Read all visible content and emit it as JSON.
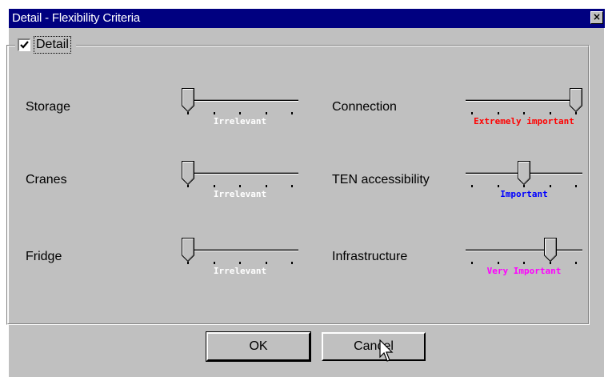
{
  "window": {
    "title": "Detail - Flexibility Criteria",
    "close_symbol": "×"
  },
  "group": {
    "label": "Detail",
    "checked": true
  },
  "criteria": [
    {
      "name": "Storage",
      "importance": "Irrelevant",
      "level": 0,
      "color": "#ffffff"
    },
    {
      "name": "Cranes",
      "importance": "Irrelevant",
      "level": 0,
      "color": "#ffffff"
    },
    {
      "name": "Fridge",
      "importance": "Irrelevant",
      "level": 0,
      "color": "#ffffff"
    },
    {
      "name": "Connection",
      "importance": "Extremely important",
      "level": 4,
      "color": "#ff0000"
    },
    {
      "name": "TEN accessibility",
      "importance": "Important",
      "level": 2,
      "color": "#0000ff"
    },
    {
      "name": "Infrastructure",
      "importance": "Very Important",
      "level": 3,
      "color": "#ff00ff"
    }
  ],
  "buttons": {
    "ok": "OK",
    "cancel": "Cancel"
  }
}
